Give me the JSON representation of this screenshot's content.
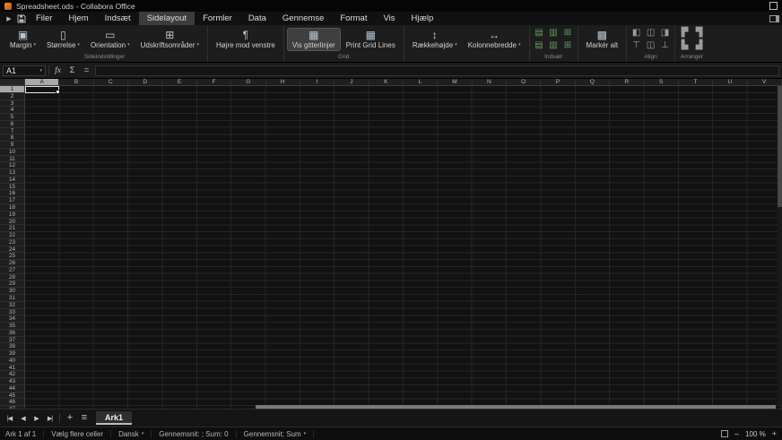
{
  "colors": {
    "accent_active": "#3f3f3f",
    "insert_icon_green": "#5f9e5f",
    "ribbon_icon_blue": "#b9c7d4",
    "selection_border": "#e4e8e4",
    "header_selected": "#a9a9a9"
  },
  "window": {
    "title": "Spreadsheet.ods - Collabora Office"
  },
  "menubar": {
    "items": [
      {
        "id": "filer",
        "label": "Filer"
      },
      {
        "id": "hjem",
        "label": "Hjem"
      },
      {
        "id": "indsaet",
        "label": "Indsæt"
      },
      {
        "id": "sidelayout",
        "label": "Sidelayout",
        "active": true
      },
      {
        "id": "formler",
        "label": "Formler"
      },
      {
        "id": "data",
        "label": "Data"
      },
      {
        "id": "gennemse",
        "label": "Gennemse"
      },
      {
        "id": "format",
        "label": "Format"
      },
      {
        "id": "vis",
        "label": "Vis"
      },
      {
        "id": "hjaelp",
        "label": "Hjælp"
      }
    ]
  },
  "ribbon": {
    "groups": [
      {
        "id": "sideindstillinger",
        "label": "Sideindstillinger",
        "buttons": [
          {
            "id": "margin",
            "label": "Margin",
            "icon": "margin",
            "dropdown": true
          },
          {
            "id": "stoerrelse",
            "label": "Størrelse",
            "icon": "page-size",
            "dropdown": true
          },
          {
            "id": "orientation",
            "label": "Orientation",
            "icon": "orientation",
            "dropdown": true
          },
          {
            "id": "udskriftsomraader",
            "label": "Udskriftsområder",
            "icon": "print-area",
            "dropdown": true
          }
        ]
      },
      {
        "id": "direction",
        "label": "",
        "buttons": [
          {
            "id": "hoejre-mod-venstre",
            "label": "Højre mod venstre",
            "icon": "rtl"
          }
        ]
      },
      {
        "id": "grid",
        "label": "Grid",
        "buttons": [
          {
            "id": "vis-gitterlinjer",
            "label": "Vis gitterlinjer",
            "icon": "view-gridlines",
            "active": true
          },
          {
            "id": "print-grid-lines",
            "label": "Print Grid Lines",
            "icon": "print-gridlines"
          }
        ]
      },
      {
        "id": "dimension",
        "label": "",
        "buttons": [
          {
            "id": "raekkehoejde",
            "label": "Rækkehøjde",
            "icon": "row-height",
            "dropdown": true
          },
          {
            "id": "kolonnebredde",
            "label": "Kolonnebredde",
            "icon": "column-width",
            "dropdown": true
          }
        ]
      },
      {
        "id": "indsaet-gruppe",
        "label": "Indsæt",
        "icon_grid": [
          [
            "insert-row-above",
            "insert-column-before",
            "insert-cells-down"
          ],
          [
            "insert-row-below",
            "insert-column-after",
            "insert-cells-right"
          ]
        ]
      },
      {
        "id": "marker",
        "label": "",
        "buttons": [
          {
            "id": "marker-alt",
            "label": "Markér alt",
            "icon": "select-all"
          }
        ]
      },
      {
        "id": "align",
        "label": "Align",
        "icon_grid": [
          [
            "align-left",
            "align-center",
            "align-right"
          ],
          [
            "align-top",
            "align-middle",
            "align-bottom"
          ]
        ]
      },
      {
        "id": "arranger",
        "label": "Arrangér",
        "icon_grid": [
          [
            "bring-to-front",
            "bring-forward"
          ],
          [
            "send-backward",
            "send-to-back"
          ]
        ]
      }
    ]
  },
  "formula_bar": {
    "cell_reference": "A1",
    "name_box_caret": "▾",
    "function_wizard": "fx",
    "sum": "Σ",
    "equals": "=",
    "input_value": ""
  },
  "grid": {
    "columns": [
      "A",
      "B",
      "C",
      "D",
      "E",
      "F",
      "G",
      "H",
      "I",
      "J",
      "K",
      "L",
      "M",
      "N",
      "O",
      "P",
      "Q",
      "R",
      "S",
      "T",
      "U",
      "V"
    ],
    "row_count": 47,
    "selected_cell": "A1",
    "selected_column": "A",
    "selected_row": 1
  },
  "sheet_bar": {
    "nav": [
      {
        "id": "first",
        "glyph": "|◀"
      },
      {
        "id": "previous",
        "glyph": "◀"
      },
      {
        "id": "next",
        "glyph": "▶"
      },
      {
        "id": "last",
        "glyph": "▶|"
      }
    ],
    "add_sheet": "+",
    "sheet_menu": "≡",
    "tabs": [
      {
        "label": "Ark1",
        "active": true
      }
    ]
  },
  "status_bar": {
    "items": [
      {
        "id": "sheet-number",
        "label": "Ark 1 af 1"
      },
      {
        "id": "selection-mode",
        "label": "Vælg flere celler"
      },
      {
        "id": "language",
        "label": "Dansk",
        "dropdown": true
      },
      {
        "id": "stats",
        "label": "Gennemsnit: ; Sum: 0"
      },
      {
        "id": "stats-selector",
        "label": "Gennemsnit; Sum",
        "dropdown": true
      }
    ],
    "zoom": {
      "out": "–",
      "level": "100 %",
      "in": "+"
    }
  }
}
